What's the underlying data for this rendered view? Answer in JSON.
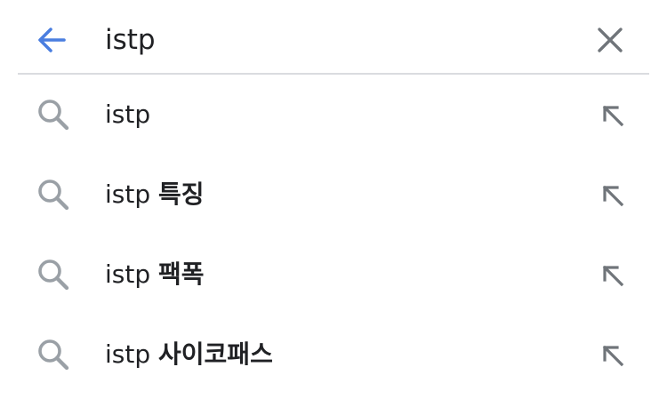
{
  "search": {
    "query": "istp",
    "accent_color": "#4a7ee0",
    "icon_color": "#9aa0a6",
    "back_icon": "arrow-left-icon",
    "clear_icon": "close-icon"
  },
  "suggestions": [
    {
      "prefix": "istp",
      "completion": "",
      "icon": "search-icon",
      "action_icon": "arrow-up-left-icon"
    },
    {
      "prefix": "istp",
      "completion": "특징",
      "icon": "search-icon",
      "action_icon": "arrow-up-left-icon"
    },
    {
      "prefix": "istp",
      "completion": "팩폭",
      "icon": "search-icon",
      "action_icon": "arrow-up-left-icon"
    },
    {
      "prefix": "istp",
      "completion": "사이코패스",
      "icon": "search-icon",
      "action_icon": "arrow-up-left-icon"
    }
  ]
}
